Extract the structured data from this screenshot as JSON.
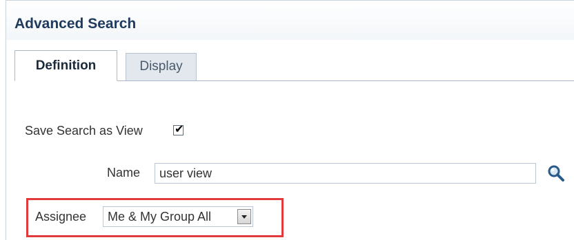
{
  "header": {
    "title": "Advanced Search"
  },
  "tabs": [
    {
      "label": "Definition",
      "active": true
    },
    {
      "label": "Display",
      "active": false
    }
  ],
  "form": {
    "save_search_label": "Save Search as View",
    "save_search_checked": true,
    "name_label": "Name",
    "name_value": "user view",
    "assignee_label": "Assignee",
    "assignee_value": "Me & My Group All"
  },
  "icons": {
    "search": "search-icon",
    "dropdown": "chevron-down-icon"
  },
  "colors": {
    "title": "#1f3a5c",
    "highlight": "#e03a3a",
    "search_icon": "#2a5a8a"
  }
}
